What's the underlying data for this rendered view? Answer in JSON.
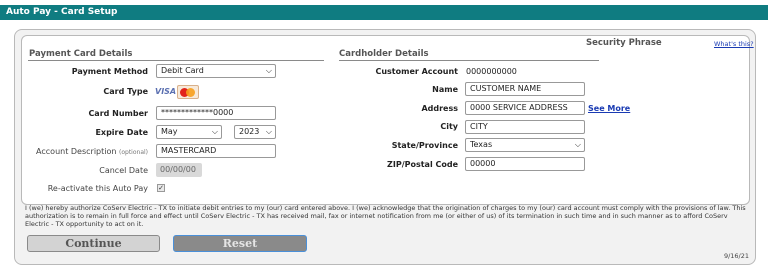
{
  "window": {
    "title": "Auto Pay - Card Setup"
  },
  "payment": {
    "section_title": "Payment Card Details",
    "method_label": "Payment Method",
    "method_value": "Debit Card",
    "card_type_label": "Card Type",
    "card_type_visa": "VISA",
    "card_number_label": "Card Number",
    "card_number_value": "*************0000",
    "expire_label": "Expire Date",
    "expire_month": "May",
    "expire_year": "2023",
    "desc_label": "Account Description",
    "desc_optional": "(optional)",
    "desc_value": "MASTERCARD",
    "cancel_label": "Cancel Date",
    "cancel_value": "00/00/00",
    "reactivate_label": "Re-activate this Auto Pay",
    "reactivate_checked": true
  },
  "cardholder": {
    "section_title": "Cardholder Details",
    "security_phrase": "Security Phrase",
    "whats_this": "What's this?",
    "account_label": "Customer Account",
    "account_value": "0000000000",
    "name_label": "Name",
    "name_value": "CUSTOMER NAME",
    "address_label": "Address",
    "address_value": "0000 SERVICE ADDRESS",
    "see_more": "See More",
    "city_label": "City",
    "city_value": "CITY",
    "state_label": "State/Province",
    "state_value": "Texas",
    "zip_label": "ZIP/Postal Code",
    "zip_value": "00000"
  },
  "authorization_text": "I (we) hereby authorize CoServ Electric - TX to initiate debit entries to my (our) card entered above. I (we) acknowledge that the origination of charges to my (our) card account must comply with the provisions of law. This authorization is to remain in full force and effect until CoServ Electric - TX has received mail, fax or internet notification from me (or either of us) of its termination in such time and in such manner as to afford CoServ Electric - TX opportunity to act on it.",
  "buttons": {
    "continue": "Continue",
    "reset": "Reset"
  },
  "footer_date": "9/16/21",
  "icons": {
    "dropdown": "chevron-down-icon",
    "check": "checkmark-icon",
    "mastercard": "mastercard-logo-icon"
  },
  "colors": {
    "titlebar": "#0f7c81",
    "link": "#1a3bb3"
  }
}
